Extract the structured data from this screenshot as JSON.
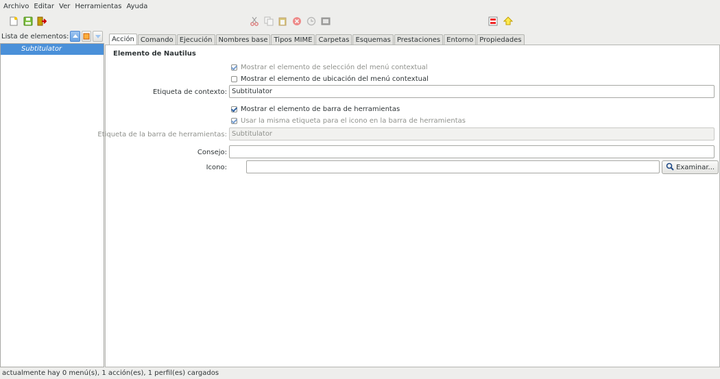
{
  "menu": [
    "Archivo",
    "Editar",
    "Ver",
    "Herramientas",
    "Ayuda"
  ],
  "toolbar_icons": {
    "new": "new-document-icon",
    "save": "save-icon",
    "quit": "quit-icon",
    "cut": "cut-icon",
    "copy": "copy-icon",
    "paste": "paste-icon",
    "delete": "delete-icon",
    "undo": "undo-icon",
    "export": "export-icon",
    "import": "import-icon",
    "preferences": "preferences-icon"
  },
  "sidebar": {
    "label": "Lista de elementos:",
    "items": [
      "Subtitulator"
    ]
  },
  "tabs": [
    "Acción",
    "Comando",
    "Ejecución",
    "Nombres base",
    "Tipos MIME",
    "Carpetas",
    "Esquemas",
    "Prestaciones",
    "Entorno",
    "Propiedades"
  ],
  "action": {
    "section_title": "Elemento de Nautilus",
    "chk_selection_menu": "Mostrar el elemento de selección del menú contextual",
    "chk_location_menu": "Mostrar el elemento de ubicación del menú contextual",
    "context_label": "Etiqueta de contexto:",
    "context_value": "Subtitulator",
    "chk_toolbar": "Mostrar el elemento de barra de herramientas",
    "chk_same_label": "Usar la misma etiqueta para el icono en la barra de herramientas",
    "toolbar_label": "Etiqueta de la barra de herramientas:",
    "toolbar_value": "Subtitulator",
    "tooltip_label": "Consejo:",
    "tooltip_value": "",
    "icon_label": "Icono:",
    "icon_value": "",
    "browse_button": "Examinar..."
  },
  "status": "actualmente hay 0 menú(s), 1 acción(es), 1 perfil(es) cargados",
  "colors": {
    "selection": "#4a90d9",
    "background": "#eeeeec"
  }
}
